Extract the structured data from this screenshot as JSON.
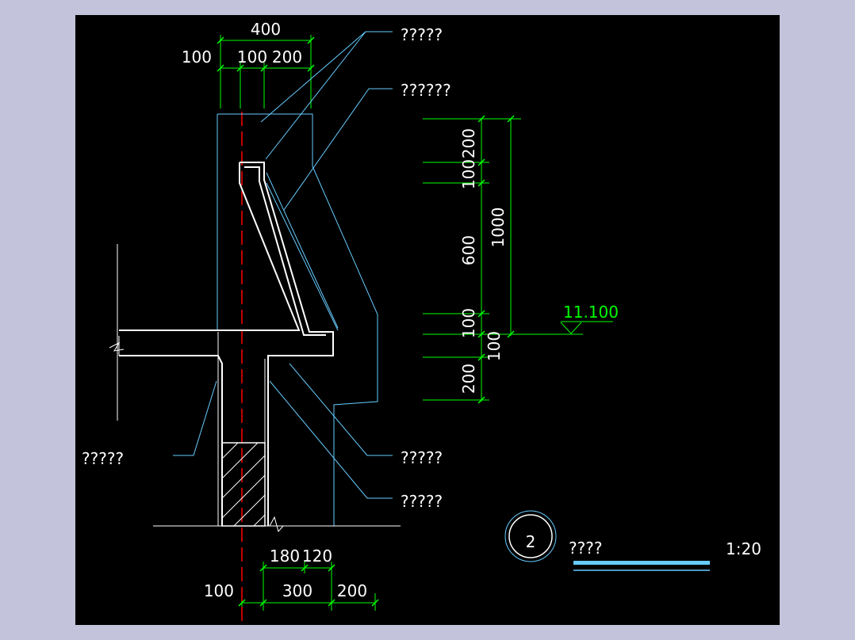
{
  "colors": {
    "background": "#000000",
    "frame": "#c3c3db",
    "dimension": "#00ff00",
    "outline": "#ffffff",
    "leader": "#66ccff",
    "centerline": "#ff0000",
    "title_underline": "#66ccff"
  },
  "dimensions": {
    "top_total": "400",
    "top_left": "100",
    "top_mid": "100",
    "top_right": "200",
    "right_200": "200",
    "right_100a": "100",
    "right_600": "600",
    "right_100b": "100",
    "right_100c": "100",
    "right_200b": "200",
    "right_total": "1000",
    "bottom_180": "180",
    "bottom_120": "120",
    "bottom_left": "100",
    "bottom_300": "300",
    "bottom_200": "200"
  },
  "elevation": "11.100",
  "labels": {
    "top_1": "?????",
    "top_2": "??????",
    "left_1": "?????",
    "right_1": "?????",
    "right_2": "?????"
  },
  "title": {
    "number": "2",
    "text": "????",
    "scale": "1:20"
  }
}
